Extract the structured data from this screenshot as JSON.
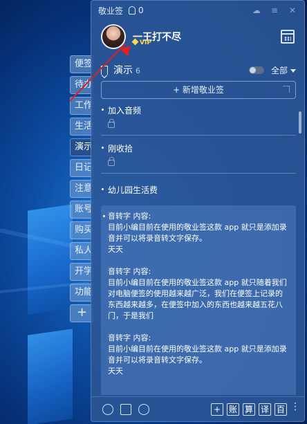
{
  "desktop": {
    "background": "windows-10-hero"
  },
  "tabs": [
    {
      "label": "便签"
    },
    {
      "label": "待办"
    },
    {
      "label": "工作"
    },
    {
      "label": "生活"
    },
    {
      "label": "演示"
    },
    {
      "label": "日记"
    },
    {
      "label": "注意"
    },
    {
      "label": "账号"
    },
    {
      "label": "购买"
    },
    {
      "label": "私人"
    },
    {
      "label": "开学"
    },
    {
      "label": "功能"
    },
    {
      "label": "+"
    }
  ],
  "window": {
    "app_name": "敬业签",
    "notify_count": "0",
    "icons": [
      "cloud-icon",
      "menu-icon",
      "close-icon"
    ]
  },
  "profile": {
    "name": "一王打不尽",
    "badge": "VIP"
  },
  "list_header": {
    "name": "演示",
    "count": "6",
    "filter": "全部"
  },
  "new_note": {
    "label": "+ 新增敬业签"
  },
  "notes": [
    {
      "title": "加入音频"
    },
    {
      "title": "刚收拾"
    },
    {
      "title": "幼儿园生活费"
    }
  ],
  "big_note": {
    "text": "音转字 内容:\n目前小编目前在使用的敬业签这款 app 就只是添加录音并可以将录音转文字保存。\n天天\n\n音转字 内容:\n目前小编目前在使用的敬业签这款 app 就只随着我们对电脑便签的使用越来越广泛，我们在便签上记录的东西越来越多，在便签中加入的东西也越来越五花八门，于是我们\n\n音转字 内容:\n目前小编目前在使用的敬业签这款 app 就只是添加录音并可以将录音转文字保存。\n天天"
  },
  "footer": {
    "buttons": [
      "+",
      "账",
      "算",
      "译",
      "百"
    ]
  },
  "colors": {
    "annotation": "#e02020",
    "panel": "#2c5696",
    "vip": "#ffd84a"
  }
}
